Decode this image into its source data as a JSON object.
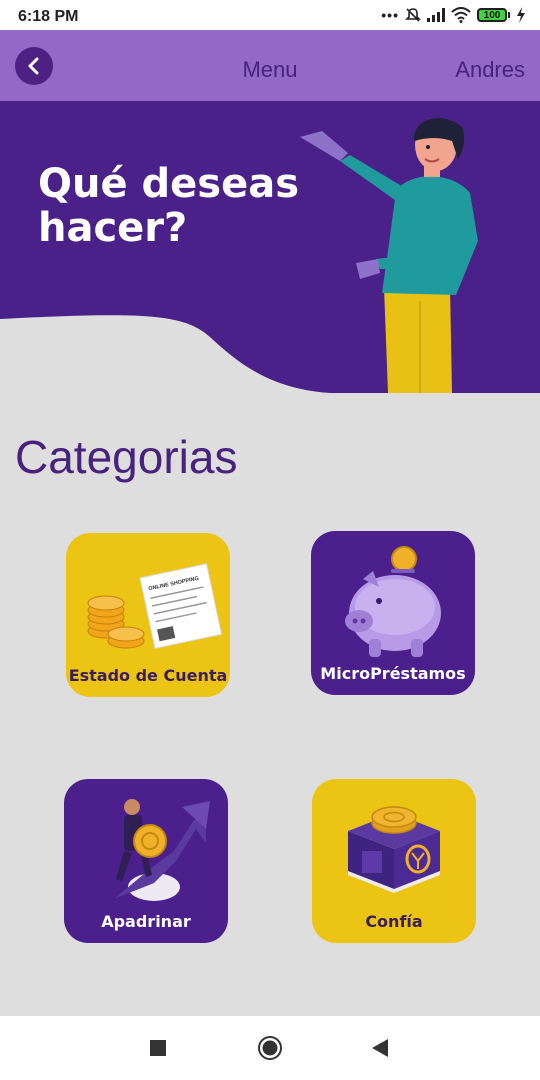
{
  "status_bar": {
    "time": "6:18 PM",
    "battery": "100"
  },
  "app_bar": {
    "title": "Menu",
    "user": "Andres"
  },
  "hero": {
    "text": "Qué deseas hacer?"
  },
  "section": {
    "title": "Categorias"
  },
  "categories": [
    {
      "label": "Estado de Cuenta",
      "color": "#ecc414"
    },
    {
      "label": "MicroPréstamos",
      "color": "#4b1f8c"
    },
    {
      "label": "Apadrinar",
      "color": "#4b1f8c"
    },
    {
      "label": "Confía",
      "color": "#ecc414"
    }
  ],
  "receipt_heading": "ONLINE SHOPPING",
  "colors": {
    "appbar": "#9368c8",
    "hero": "#4a2188",
    "accent_yellow": "#ecc414",
    "brand_purple": "#48227d"
  }
}
